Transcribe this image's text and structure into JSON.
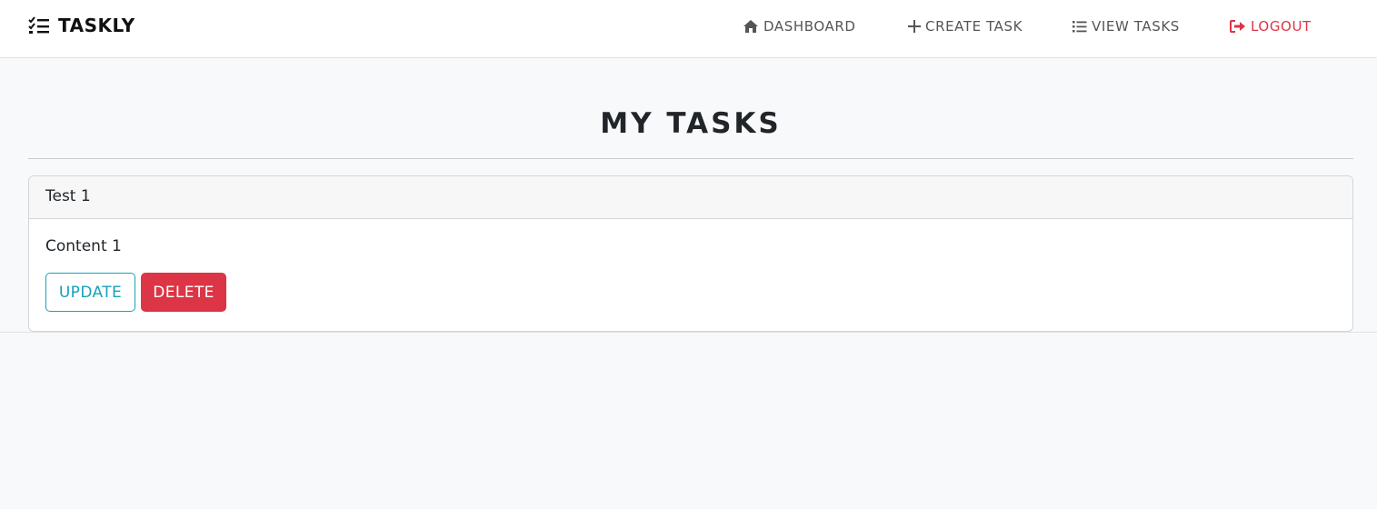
{
  "navbar": {
    "brand": "TASKLY",
    "links": {
      "dashboard": "DASHBOARD",
      "create_task": "CREATE TASK",
      "view_tasks": "VIEW TASKS",
      "logout": "LOGOUT"
    }
  },
  "main": {
    "title": "MY TASKS",
    "tasks": [
      {
        "title": "Test 1",
        "content": "Content 1",
        "update_label": "UPDATE",
        "delete_label": "DELETE"
      }
    ]
  },
  "colors": {
    "accent_info": "#17a2b8",
    "danger": "#dc3545",
    "page_bg": "#f8f9fa"
  },
  "icons": {
    "brand": "tasks-list-icon",
    "dashboard": "home-icon",
    "create_task": "plus-icon",
    "view_tasks": "list-icon",
    "logout": "sign-out-icon"
  }
}
